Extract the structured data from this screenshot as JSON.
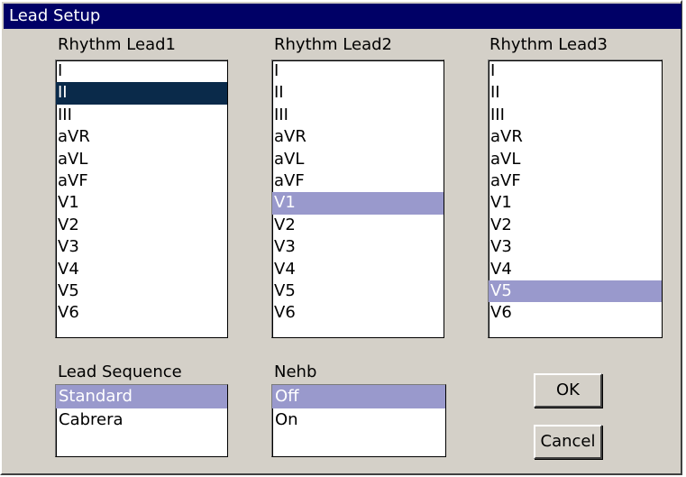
{
  "window": {
    "title": "Lead Setup"
  },
  "rhythm_leads": [
    {
      "label": "Rhythm Lead1",
      "items": [
        "I",
        "II",
        "III",
        "aVR",
        "aVL",
        "aVF",
        "V1",
        "V2",
        "V3",
        "V4",
        "V5",
        "V6"
      ],
      "selected": "II",
      "style": "dark"
    },
    {
      "label": "Rhythm Lead2",
      "items": [
        "I",
        "II",
        "III",
        "aVR",
        "aVL",
        "aVF",
        "V1",
        "V2",
        "V3",
        "V4",
        "V5",
        "V6"
      ],
      "selected": "V1",
      "style": "light"
    },
    {
      "label": "Rhythm Lead3",
      "items": [
        "I",
        "II",
        "III",
        "aVR",
        "aVL",
        "aVF",
        "V1",
        "V2",
        "V3",
        "V4",
        "V5",
        "V6"
      ],
      "selected": "V5",
      "style": "light"
    }
  ],
  "lead_sequence": {
    "label": "Lead Sequence",
    "items": [
      "Standard",
      "Cabrera"
    ],
    "selected": "Standard"
  },
  "nehb": {
    "label": "Nehb",
    "items": [
      "Off",
      "On"
    ],
    "selected": "Off"
  },
  "buttons": {
    "ok": "OK",
    "cancel": "Cancel"
  },
  "colors": {
    "title_bg": "#000066",
    "selected_focus": "#0a2a4a",
    "selected_inactive": "#9999cc",
    "dialog_bg": "#d4d0c8"
  }
}
